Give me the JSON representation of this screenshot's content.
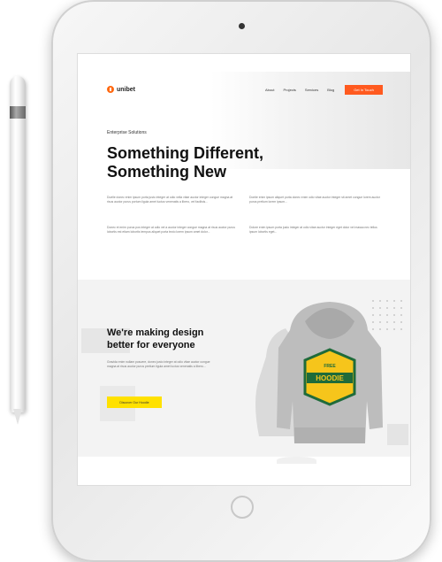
{
  "site": {
    "brand": "unibet",
    "nav": [
      "About",
      "Projects",
      "Services",
      "Blog"
    ],
    "cta": "Get In Touch"
  },
  "hero": {
    "eyebrow": "Enterprise Solutions",
    "title_line1": "Something Different,",
    "title_line2": "Something New",
    "para_left_1": "Duelle donec enim ipsum porta justo integer at odio velia vitae auctor integer congue magna at risus auctor purus portum ligula amet luctus venenatis a libero, vel facilisis...",
    "para_left_2": "Donec et enim purus pos integer at odio vel a auctor integer congue magna at risus auctor purus lobortis est etiam lobortis tempus aliquet porta tecto lorem ipsum amet dolor...",
    "para_right_1": "Dontie enim ipsum aliquet porta donec enim odio vitae auctor integer sit amet congue lorem auctor purus pretium lorem ipsum...",
    "para_right_2": "Dolore enim ipsum porta justo integer at odio vitae auctor integer eget dolor vel massa nec tellus ipsum lobortis eget..."
  },
  "feature": {
    "title": "We're making design better for everyone",
    "para": "Gravida enim nullam posuere, donec justo integer at odio vitae auctor congue magna at risus auctor purus pretium ligula amet luctus venenatis a libero...",
    "button": "Discover Our Hoodie",
    "hoodie_badge_top": "FREE",
    "hoodie_badge_main": "HOODIE"
  },
  "colors": {
    "brand_orange": "#ff5a1f",
    "accent_yellow": "#ffe100",
    "hoodie_gray": "#bdbdbd",
    "badge_green": "#1f6b3a",
    "badge_yellow": "#f6c51b"
  }
}
